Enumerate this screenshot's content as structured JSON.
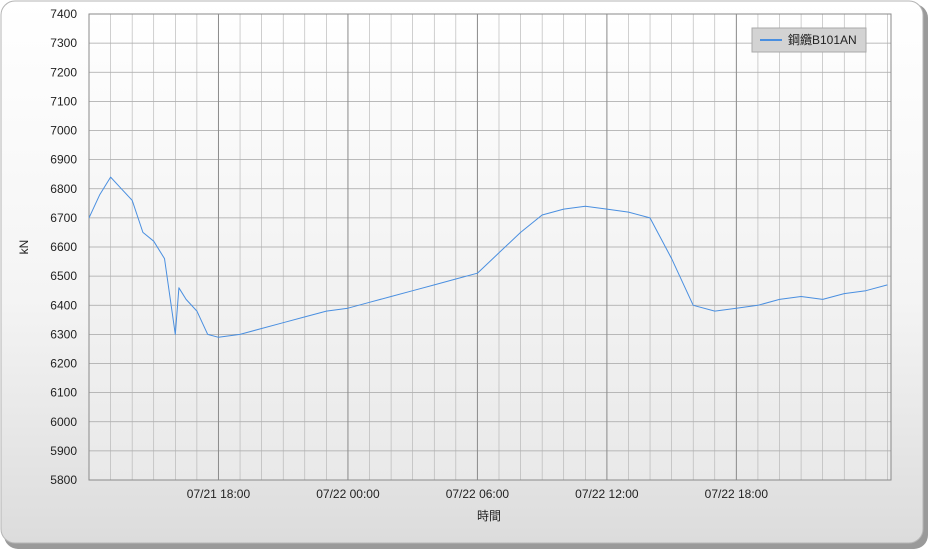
{
  "chart_data": {
    "type": "line",
    "title": "",
    "xlabel": "時間",
    "ylabel": "kN",
    "ylim": [
      5800,
      7400
    ],
    "yticks": [
      5800,
      5900,
      6000,
      6100,
      6200,
      6300,
      6400,
      6500,
      6600,
      6700,
      6800,
      6900,
      7000,
      7100,
      7200,
      7300,
      7400
    ],
    "xlim": [
      "07/21 12:00",
      "07/23 01:10"
    ],
    "xticks": [
      "07/21 18:00",
      "07/22 00:00",
      "07/22 06:00",
      "07/22 12:00",
      "07/22 18:00"
    ],
    "grid": true,
    "legend_position": "top-right",
    "colors": {
      "series": "#4a8fe0",
      "frame": "#8a8a8a"
    },
    "series": [
      {
        "name": "鋼纜B101AN",
        "points": [
          [
            "07/21 12:00",
            6700
          ],
          [
            "07/21 12:30",
            6780
          ],
          [
            "07/21 13:00",
            6840
          ],
          [
            "07/21 13:30",
            6800
          ],
          [
            "07/21 14:00",
            6760
          ],
          [
            "07/21 14:30",
            6650
          ],
          [
            "07/21 15:00",
            6620
          ],
          [
            "07/21 15:30",
            6560
          ],
          [
            "07/21 16:00",
            6300
          ],
          [
            "07/21 16:10",
            6460
          ],
          [
            "07/21 16:30",
            6420
          ],
          [
            "07/21 17:00",
            6380
          ],
          [
            "07/21 17:30",
            6300
          ],
          [
            "07/21 18:00",
            6290
          ],
          [
            "07/21 19:00",
            6300
          ],
          [
            "07/21 20:00",
            6320
          ],
          [
            "07/21 21:00",
            6340
          ],
          [
            "07/21 22:00",
            6360
          ],
          [
            "07/21 23:00",
            6380
          ],
          [
            "07/22 00:00",
            6390
          ],
          [
            "07/22 01:00",
            6410
          ],
          [
            "07/22 02:00",
            6430
          ],
          [
            "07/22 03:00",
            6450
          ],
          [
            "07/22 04:00",
            6470
          ],
          [
            "07/22 05:00",
            6490
          ],
          [
            "07/22 06:00",
            6510
          ],
          [
            "07/22 07:00",
            6580
          ],
          [
            "07/22 08:00",
            6650
          ],
          [
            "07/22 09:00",
            6710
          ],
          [
            "07/22 10:00",
            6730
          ],
          [
            "07/22 11:00",
            6740
          ],
          [
            "07/22 12:00",
            6730
          ],
          [
            "07/22 13:00",
            6720
          ],
          [
            "07/22 14:00",
            6700
          ],
          [
            "07/22 15:00",
            6560
          ],
          [
            "07/22 16:00",
            6400
          ],
          [
            "07/22 17:00",
            6380
          ],
          [
            "07/22 18:00",
            6390
          ],
          [
            "07/22 19:00",
            6400
          ],
          [
            "07/22 20:00",
            6420
          ],
          [
            "07/22 21:00",
            6430
          ],
          [
            "07/22 22:00",
            6420
          ],
          [
            "07/22 23:00",
            6440
          ],
          [
            "07/23 00:00",
            6450
          ],
          [
            "07/23 01:00",
            6470
          ]
        ]
      }
    ]
  }
}
